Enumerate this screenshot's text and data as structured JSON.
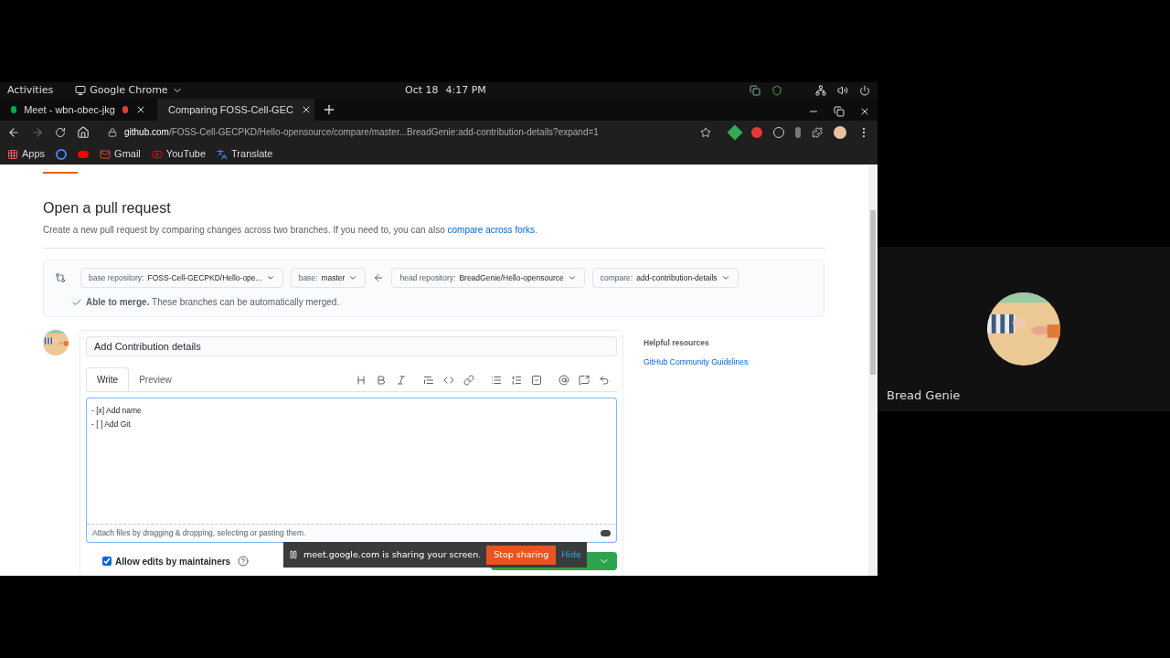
{
  "topbar": {
    "activities": "Activities",
    "app": "Google Chrome",
    "date": "Oct 18",
    "time": "4:17 PM"
  },
  "browser": {
    "tabs": [
      {
        "title": "Meet - wbn-obec-jkg",
        "selected": false,
        "recording": true
      },
      {
        "title": "Comparing FOSS-Cell-GEC",
        "selected": true,
        "recording": false
      }
    ],
    "url_host": "github.com",
    "url_path": "/FOSS-Cell-GECPKD/Hello-opensource/compare/master...BreadGenie:add-contribution-details?expand=1",
    "bookmarks": [
      {
        "label": "Apps",
        "kind": "apps"
      },
      {
        "label": "Gmail",
        "kind": "gmail"
      },
      {
        "label": "YouTube",
        "kind": "youtube"
      },
      {
        "label": "Translate",
        "kind": "translate"
      }
    ]
  },
  "page": {
    "title": "Open a pull request",
    "description": "Create a new pull request by comparing changes across two branches. If you need to, you can also ",
    "description_link": "compare across forks",
    "description_end": ".",
    "selectors": [
      {
        "label": "base repository:",
        "value": "FOSS-Cell-GECPKD/Hello-ope..."
      },
      {
        "label": "base:",
        "value": "master"
      },
      {
        "label": "head repository:",
        "value": "BreadGenie/Hello-opensource"
      },
      {
        "label": "compare:",
        "value": "add-contribution-details"
      }
    ],
    "merge": "**Able to merge.** These branches can be automatically merged.",
    "form": {
      "title_value": "Add Contribution details",
      "tabs": [
        {
          "label": "Write",
          "selected": true
        },
        {
          "label": "Preview",
          "selected": false
        }
      ],
      "body": "- [x] Add name\n- [ ] Add Git",
      "attach_hint": "Attach files by dragging & dropping, selecting or pasting them.",
      "allow_edits": {
        "label": "Allow edits by maintainers",
        "checked": true
      }
    },
    "sidebar": {
      "heading": "Helpful resources",
      "link": "GitHub Community Guidelines"
    }
  },
  "toast": {
    "text": "meet.google.com is sharing your screen.",
    "stop": "Stop sharing",
    "hide": "Hide"
  },
  "participant": {
    "name": "Bread Genie"
  }
}
